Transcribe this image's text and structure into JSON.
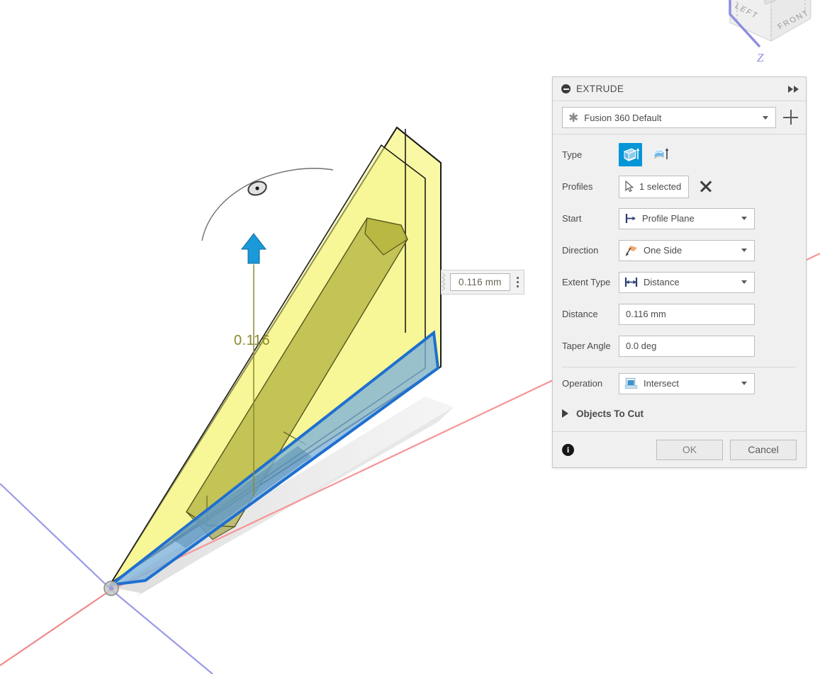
{
  "app": {
    "name": "Fusion 360",
    "viewport_background": "#ffffff"
  },
  "viewcube": {
    "face_left": "LEFT",
    "face_front": "FRONT",
    "axis_label_z": "Z",
    "axis_color_z": "#8e8ee0",
    "axis_color_y": "#53d050"
  },
  "viewport": {
    "dimension_text": "0.116",
    "dimension_text_color": "#8a8a2e",
    "origin_axis_x_color": "#f2a0a0",
    "origin_axis_y_color": "#9a9ae8",
    "profile_highlight_color": "#1f6fd0",
    "profile_fill_color": "#7fb0d8",
    "extrude_preview_color": "#f5f58a",
    "intersect_body_color": "#9d9d2e",
    "manipulator_arrow_color": "#1a9ad8"
  },
  "dimension_input": {
    "value": "0.116 mm",
    "grip_name": "drag-grip",
    "menu_name": "options-menu"
  },
  "panel": {
    "title": "EXTRUDE",
    "collapse_icon": "minus-circle-icon",
    "expand_icon": "fast-forward-icon",
    "preset": {
      "icon": "asterisk-icon",
      "value": "Fusion 360 Default",
      "add_label": "+"
    },
    "rows": [
      {
        "key": "type",
        "label": "Type",
        "control": "icon-toggle",
        "options": [
          "extrude-solid-icon",
          "extrude-tapered-icon"
        ],
        "selected_index": 0
      },
      {
        "key": "profiles",
        "label": "Profiles",
        "control": "selection",
        "value": "1 selected",
        "icon": "cursor-arrow-icon",
        "clear_icon": "x-icon"
      },
      {
        "key": "start",
        "label": "Start",
        "control": "dropdown",
        "value": "Profile Plane",
        "icon": "profile-plane-icon"
      },
      {
        "key": "direction",
        "label": "Direction",
        "control": "dropdown",
        "value": "One Side",
        "icon": "one-side-arrow-icon"
      },
      {
        "key": "extent_type",
        "label": "Extent Type",
        "control": "dropdown",
        "value": "Distance",
        "icon": "distance-icon"
      },
      {
        "key": "distance",
        "label": "Distance",
        "control": "text",
        "value": "0.116 mm"
      },
      {
        "key": "taper_angle",
        "label": "Taper Angle",
        "control": "text",
        "value": "0.0 deg"
      },
      {
        "key": "operation",
        "label": "Operation",
        "control": "dropdown",
        "value": "Intersect",
        "icon": "intersect-icon"
      }
    ],
    "objects_to_cut": {
      "label": "Objects To Cut",
      "expanded": false,
      "icon": "triangle-right-icon"
    },
    "footer": {
      "info_icon": "info-icon",
      "ok_label": "OK",
      "cancel_label": "Cancel",
      "ok_enabled": false
    },
    "accent_color": "#0696d7"
  }
}
